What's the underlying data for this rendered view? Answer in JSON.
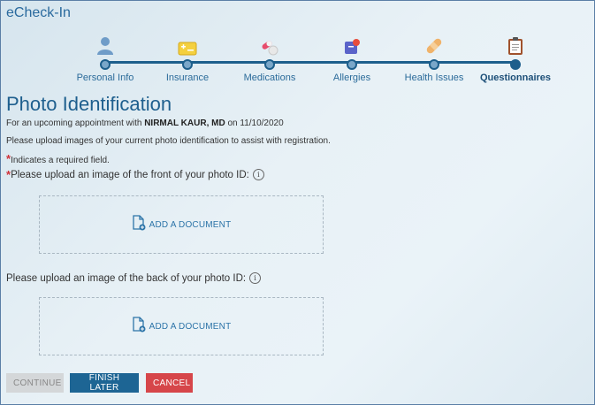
{
  "app": {
    "title": "eCheck-In"
  },
  "stepper": {
    "steps": [
      {
        "label": "Personal Info",
        "icon": "person-icon",
        "active": false
      },
      {
        "label": "Insurance",
        "icon": "insurance-card-icon",
        "active": false
      },
      {
        "label": "Medications",
        "icon": "pills-icon",
        "active": false
      },
      {
        "label": "Allergies",
        "icon": "allergy-icon",
        "active": false
      },
      {
        "label": "Health Issues",
        "icon": "bandage-icon",
        "active": false
      },
      {
        "label": "Questionnaires",
        "icon": "clipboard-icon",
        "active": true
      }
    ]
  },
  "page": {
    "title": "Photo Identification",
    "appointment_prefix": "For an upcoming appointment with",
    "provider": "NIRMAL KAUR, MD",
    "date_prefix": "on",
    "date": "11/10/2020",
    "instructions": "Please upload images of your current photo identification to assist with registration.",
    "required_star": "*",
    "required_note": "Indicates a required field."
  },
  "front": {
    "label": "Please upload an image of the front of your photo ID:",
    "info_glyph": "i",
    "add_label": "ADD A DOCUMENT"
  },
  "back": {
    "label": "Please upload an image of the back of your photo ID:",
    "info_glyph": "i",
    "add_label": "ADD A DOCUMENT"
  },
  "actions": {
    "continue_label": "CONTINUE",
    "finish_later_label": "FINISH LATER",
    "cancel_label": "CANCEL"
  },
  "colors": {
    "accent": "#1d6594",
    "link": "#2c74a8",
    "danger": "#d6464a",
    "required": "#d0323a"
  }
}
